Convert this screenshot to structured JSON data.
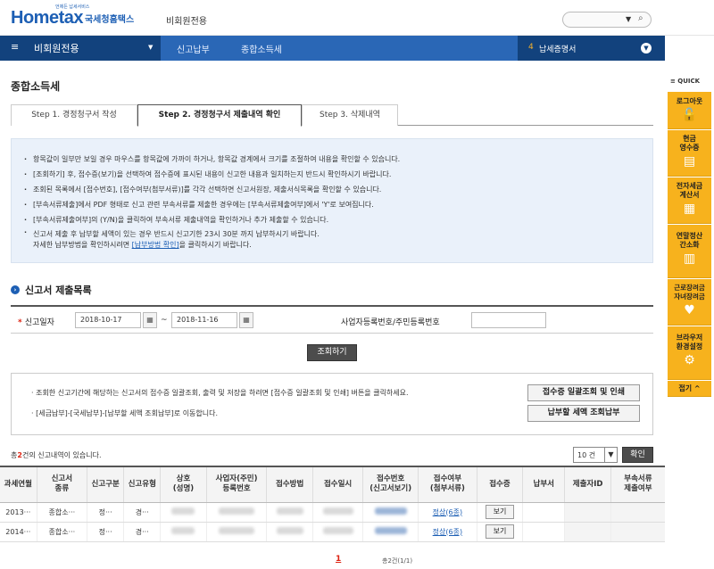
{
  "header": {
    "logo_text": "Hometax",
    "logo_sub": "국세청홈택스",
    "logo_tag": "언제든 납세서비스",
    "nonmember": "비회원전용",
    "search_placeholder": ""
  },
  "nav": {
    "menu_label": "비회원전용",
    "crumb1": "신고납부",
    "crumb2": "종합소득세",
    "cert_num": "4",
    "cert_label": "납세증명서"
  },
  "quick": {
    "title": "≡ QUICK",
    "items": [
      {
        "label": "로그아웃",
        "icon": "unlock-icon"
      },
      {
        "label": "현금\n영수증",
        "icon": "receipt-icon"
      },
      {
        "label": "전자세금\n계산서",
        "icon": "invoice-icon"
      },
      {
        "label": "연말정산\n간소화",
        "icon": "document-icon"
      },
      {
        "label": "근로장려금\n자녀장려금",
        "icon": "heart-icon"
      },
      {
        "label": "브라우저\n환경설정",
        "icon": "gear-icon"
      }
    ],
    "collapse_label": "접기 ^"
  },
  "page": {
    "title": "종합소득세"
  },
  "tabs": [
    {
      "label": "Step 1. 경정청구서 작성"
    },
    {
      "label": "Step 2. 경정청구서 제출내역 확인"
    },
    {
      "label": "Step 3. 삭제내역"
    }
  ],
  "info": {
    "lines": [
      "항목값이 일부만 보일 경우 마우스를 항목값에 가까이 하거나, 항목값 경계에서 크기를 조절하여 내용을 확인할 수 있습니다.",
      "[조회하기] 후, 접수증(보기)을 선택하여 접수증에 표시된 내용이 신고한 내용과 일치하는지 반드시 확인하시기 바랍니다.",
      "조회된 목록에서 [접수번호], [접수여부(첨부서류)]를 각각 선택하면 신고서원장, 제출서식목록을 확인할 수 있습니다.",
      "[부속서류제출]에서 PDF 형태로 신고 관련 부속서류를 제출한 경우에는 [부속서류제출여부]에서 'Y'로 보여집니다.",
      "[부속서류제출여부]의 (Y/N)을 클릭하여 부속서류 제출내역을 확인하거나 추가 제출할 수 있습니다.",
      "신고서 제출 후 납부할 세액이 있는 경우 반드시 신고기한 23시 30분 까지 납부하시기 바랍니다."
    ],
    "last_line_pre": "자세한 납부방법을 확인하시려면",
    "last_line_link": "[납부방법 확인]",
    "last_line_post": "을 클릭하시기 바랍니다."
  },
  "section": {
    "title": "신고서 제출목록"
  },
  "filter": {
    "date_label": "신고일자",
    "start_date": "2018-10-17",
    "end_date": "2018-11-16",
    "tilde": "~",
    "biz_label": "사업자등록번호/주민등록번호",
    "biz_value": "",
    "search_button": "조회하기"
  },
  "guide": {
    "line1": "· 조회한 신고기간에 해당하는 신고서의 접수증 일괄조회, 출력 및 저장을 하려면 [접수증 일괄조회 및 인쇄] 버튼을 클릭하세요.",
    "line2": "· [세금납부]-[국세납부]-[납부할 세액 조회납부]로 이동합니다.",
    "btn_batch": "접수증 일괄조회 및 인쇄",
    "btn_pay": "납부할 세액 조회납부"
  },
  "list": {
    "count_pre": "총",
    "count_num": "2",
    "count_post": "건의 신고내역이 있습니다.",
    "page_size": "10 건",
    "confirm_button": "확인",
    "columns": [
      "과세연월",
      "신고서\n종류",
      "신고구분",
      "신고유형",
      "상호\n(성명)",
      "사업자(주민)\n등록번호",
      "접수방법",
      "접수일시",
      "접수번호\n(신고서보기)",
      "접수여부\n(첨부서류)",
      "접수증",
      "납부서",
      "제출자ID",
      "부속서류\n제출여부"
    ],
    "rows": [
      {
        "period": "2013···",
        "type": "종합소···",
        "div": "정···",
        "kind": "경···",
        "status": "정상(6종)",
        "receipt": "보기"
      },
      {
        "period": "2014···",
        "type": "종합소···",
        "div": "정···",
        "kind": "경···",
        "status": "정상(6종)",
        "receipt": "보기"
      }
    ]
  },
  "pager": {
    "current": "1",
    "summary": "총2건(1/1)"
  }
}
